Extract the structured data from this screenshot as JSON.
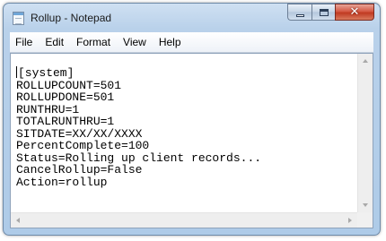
{
  "window": {
    "title": "Rollup - Notepad",
    "icon": "notepad-icon",
    "controls": {
      "minimize": "minimize-icon",
      "maximize": "maximize-icon",
      "close": "✕"
    }
  },
  "menu": [
    "File",
    "Edit",
    "Format",
    "View",
    "Help"
  ],
  "editor": {
    "lines": [
      "[system]",
      "ROLLUPCOUNT=501",
      "ROLLUPDONE=501",
      "RUNTHRU=1",
      "TOTALRUNTHRU=1",
      "SITDATE=XX/XX/XXXX",
      "PercentComplete=100",
      "Status=Rolling up client records...",
      "CancelRollup=False",
      "Action=rollup"
    ]
  },
  "colors": {
    "title_bar": "#b9d1ea",
    "close_button": "#c03a22",
    "editor_background": "#ffffff"
  }
}
